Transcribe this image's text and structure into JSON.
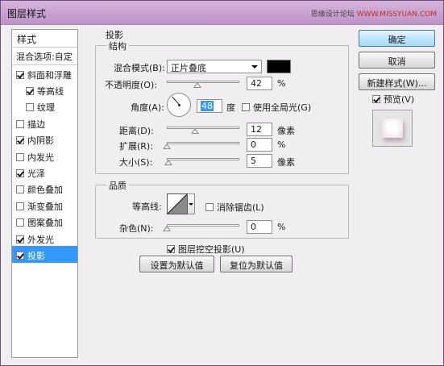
{
  "window": {
    "title": "图层样式",
    "watermark_left": "思缘设计论坛",
    "watermark_right": "WWW.MISSYUAN.COM"
  },
  "styles_list": {
    "header": "样式",
    "blending": "混合选项:自定",
    "items": [
      {
        "label": "斜面和浮雕",
        "checked": true,
        "sub": false,
        "selected": false
      },
      {
        "label": "等高线",
        "checked": true,
        "sub": true,
        "selected": false
      },
      {
        "label": "纹理",
        "checked": false,
        "sub": true,
        "selected": false
      },
      {
        "label": "描边",
        "checked": false,
        "sub": false,
        "selected": false
      },
      {
        "label": "内阴影",
        "checked": true,
        "sub": false,
        "selected": false
      },
      {
        "label": "内发光",
        "checked": false,
        "sub": false,
        "selected": false
      },
      {
        "label": "光泽",
        "checked": true,
        "sub": false,
        "selected": false
      },
      {
        "label": "颜色叠加",
        "checked": false,
        "sub": false,
        "selected": false
      },
      {
        "label": "渐变叠加",
        "checked": false,
        "sub": false,
        "selected": false
      },
      {
        "label": "图案叠加",
        "checked": false,
        "sub": false,
        "selected": false
      },
      {
        "label": "外发光",
        "checked": true,
        "sub": false,
        "selected": false
      },
      {
        "label": "投影",
        "checked": true,
        "sub": false,
        "selected": true
      }
    ]
  },
  "drop_shadow": {
    "section_title": "投影",
    "structure": {
      "title": "结构",
      "blend_mode_label": "混合模式(B):",
      "blend_mode_value": "正片叠底",
      "shadow_color": "#000000",
      "opacity_label": "不透明度(O):",
      "opacity_value": "42",
      "opacity_fraction": 0.42,
      "opacity_unit": "%",
      "angle_label": "角度(A):",
      "angle_value": "48",
      "angle_unit": "度",
      "global_light_label": "使用全局光(G)",
      "global_light_checked": false,
      "distance_label": "距离(D):",
      "distance_value": "12",
      "distance_unit": "像素",
      "spread_label": "扩展(R):",
      "spread_value": "0",
      "spread_unit": "%",
      "size_label": "大小(S):",
      "size_value": "5",
      "size_unit": "像素"
    },
    "quality": {
      "title": "品质",
      "contour_label": "等高线:",
      "anti_alias_label": "消除锯齿(L)",
      "anti_alias_checked": false,
      "noise_label": "杂色(N):",
      "noise_value": "0",
      "noise_unit": "%"
    },
    "knockout_label": "图层挖空投影(U)",
    "knockout_checked": true,
    "make_default": "设置为默认值",
    "reset_default": "复位为默认值"
  },
  "buttons": {
    "ok": "确定",
    "cancel": "取消",
    "new_style": "新建样式(W)...",
    "preview_label": "预览(V)",
    "preview_checked": true
  }
}
